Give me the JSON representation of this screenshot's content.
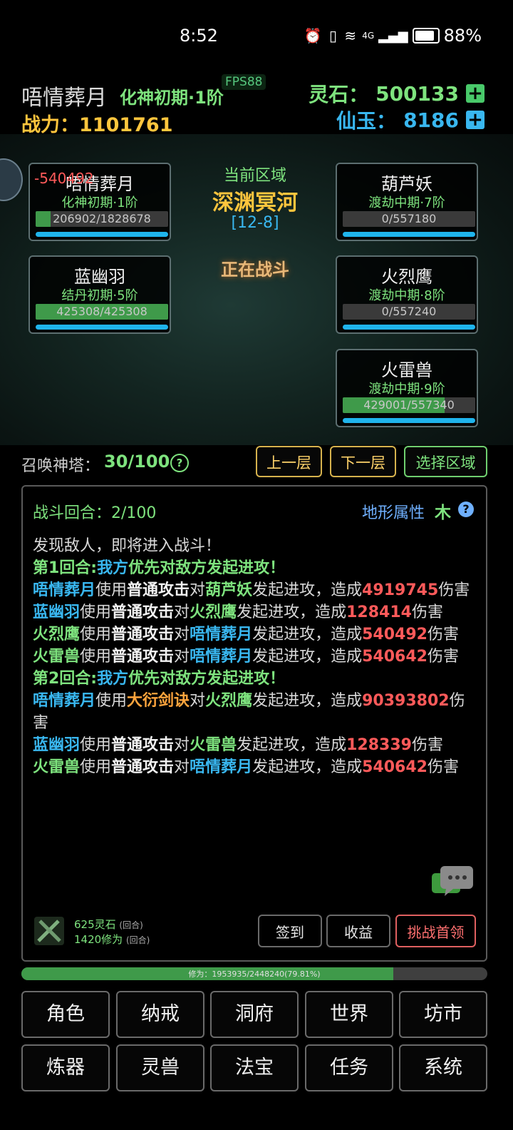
{
  "status_bar": {
    "time": "8:52",
    "network": "4G",
    "battery": "88%"
  },
  "header": {
    "player_name": "唔情葬月",
    "realm": "化神初期·1阶",
    "fps": "FPS88",
    "power_label": "战力：",
    "power_value": "1101761",
    "spirit_stone_label": "灵石：",
    "spirit_stone_value": "500133",
    "immortal_jade_label": "仙玉：",
    "immortal_jade_value": "8186"
  },
  "scene": {
    "area_label": "当前区域",
    "area_name": "深渊冥河",
    "area_code": "[12-8]",
    "battle_state": "正在战斗",
    "damage_float": "-540492",
    "allies": [
      {
        "name": "唔情葬月",
        "realm": "化神初期·1阶",
        "hp": "206902/1828678",
        "hp_fraction": 0.113
      },
      {
        "name": "蓝幽羽",
        "realm": "结丹初期·5阶",
        "hp": "425308/425308",
        "hp_fraction": 1.0
      }
    ],
    "enemies": [
      {
        "name": "葫芦妖",
        "realm": "渡劫中期·7阶",
        "hp": "0/557180",
        "hp_fraction": 0
      },
      {
        "name": "火烈鹰",
        "realm": "渡劫中期·8阶",
        "hp": "0/557240",
        "hp_fraction": 0
      },
      {
        "name": "火雷兽",
        "realm": "渡劫中期·9阶",
        "hp": "429001/557340",
        "hp_fraction": 0.77
      }
    ]
  },
  "tower": {
    "label": "召唤神塔：",
    "value": "30/100",
    "help": "?",
    "prev_label": "上一层",
    "next_label": "下一层",
    "select_label": "选择区域"
  },
  "battle": {
    "round_label": "战斗回合：2/100",
    "terrain_label": "地形属性",
    "terrain_value": "木",
    "help": "?",
    "log": [
      [
        {
          "t": "发现敌人，即将进入战斗！",
          "c": ""
        }
      ],
      [
        {
          "t": "第1回合:",
          "c": "c-green"
        },
        {
          "t": "我方",
          "c": "c-blue"
        },
        {
          "t": "优先对",
          "c": "c-green"
        },
        {
          "t": "敌方",
          "c": "c-green"
        },
        {
          "t": "发起进攻！",
          "c": "c-green"
        }
      ],
      [
        {
          "t": "唔情葬月",
          "c": "c-blue"
        },
        {
          "t": "使用",
          "c": ""
        },
        {
          "t": "普通攻击",
          "c": "c-white"
        },
        {
          "t": "对",
          "c": ""
        },
        {
          "t": "葫芦妖",
          "c": "c-green"
        },
        {
          "t": "发起进攻，造成",
          "c": ""
        },
        {
          "t": "4919745",
          "c": "c-red"
        },
        {
          "t": "伤害",
          "c": ""
        }
      ],
      [
        {
          "t": "蓝幽羽",
          "c": "c-blue"
        },
        {
          "t": "使用",
          "c": ""
        },
        {
          "t": "普通攻击",
          "c": "c-white"
        },
        {
          "t": "对",
          "c": ""
        },
        {
          "t": "火烈鹰",
          "c": "c-green"
        },
        {
          "t": "发起进攻，造成",
          "c": ""
        },
        {
          "t": "128414",
          "c": "c-red"
        },
        {
          "t": "伤害",
          "c": ""
        }
      ],
      [
        {
          "t": "火烈鹰",
          "c": "c-green"
        },
        {
          "t": "使用",
          "c": ""
        },
        {
          "t": "普通攻击",
          "c": "c-white"
        },
        {
          "t": "对",
          "c": ""
        },
        {
          "t": "唔情葬月",
          "c": "c-blue"
        },
        {
          "t": "发起进攻，造成",
          "c": ""
        },
        {
          "t": "540492",
          "c": "c-red"
        },
        {
          "t": "伤害",
          "c": ""
        }
      ],
      [
        {
          "t": "火雷兽",
          "c": "c-green"
        },
        {
          "t": "使用",
          "c": ""
        },
        {
          "t": "普通攻击",
          "c": "c-white"
        },
        {
          "t": "对",
          "c": ""
        },
        {
          "t": "唔情葬月",
          "c": "c-blue"
        },
        {
          "t": "发起进攻，造成",
          "c": ""
        },
        {
          "t": "540642",
          "c": "c-red"
        },
        {
          "t": "伤害",
          "c": ""
        }
      ],
      [
        {
          "t": "第2回合:",
          "c": "c-green"
        },
        {
          "t": "我方",
          "c": "c-blue"
        },
        {
          "t": "优先对",
          "c": "c-green"
        },
        {
          "t": "敌方",
          "c": "c-green"
        },
        {
          "t": "发起进攻！",
          "c": "c-green"
        }
      ],
      [
        {
          "t": "唔情葬月",
          "c": "c-blue"
        },
        {
          "t": "使用",
          "c": ""
        },
        {
          "t": "大衍剑诀",
          "c": "c-orange"
        },
        {
          "t": "对",
          "c": ""
        },
        {
          "t": "火烈鹰",
          "c": "c-green"
        },
        {
          "t": "发起进攻，造成",
          "c": ""
        },
        {
          "t": "90393802",
          "c": "c-red"
        },
        {
          "t": "伤害",
          "c": ""
        }
      ],
      [
        {
          "t": "蓝幽羽",
          "c": "c-blue"
        },
        {
          "t": "使用",
          "c": ""
        },
        {
          "t": "普通攻击",
          "c": "c-white"
        },
        {
          "t": "对",
          "c": ""
        },
        {
          "t": "火雷兽",
          "c": "c-green"
        },
        {
          "t": "发起进攻，造成",
          "c": ""
        },
        {
          "t": "128339",
          "c": "c-red"
        },
        {
          "t": "伤害",
          "c": ""
        }
      ],
      [
        {
          "t": "火雷兽",
          "c": "c-green"
        },
        {
          "t": "使用",
          "c": ""
        },
        {
          "t": "普通攻击",
          "c": "c-white"
        },
        {
          "t": "对",
          "c": ""
        },
        {
          "t": "唔情葬月",
          "c": "c-blue"
        },
        {
          "t": "发起进攻，造成",
          "c": ""
        },
        {
          "t": "540642",
          "c": "c-red"
        },
        {
          "t": "伤害",
          "c": ""
        }
      ]
    ],
    "reward_stone": "625灵石",
    "reward_cultivation": "1420修为",
    "reward_unit": "(回合)",
    "signin_label": "签到",
    "income_label": "收益",
    "boss_label": "挑战首领"
  },
  "xp": {
    "text": "修为：1953935/2448240(79.81%)",
    "fraction": 0.7981
  },
  "nav": [
    "角色",
    "纳戒",
    "洞府",
    "世界",
    "坊市",
    "炼器",
    "灵兽",
    "法宝",
    "任务",
    "系统"
  ],
  "colors": {
    "green": "#7ee37e",
    "blue": "#39b7f0",
    "gold": "#ffc53d",
    "red": "#ff5a5a"
  }
}
